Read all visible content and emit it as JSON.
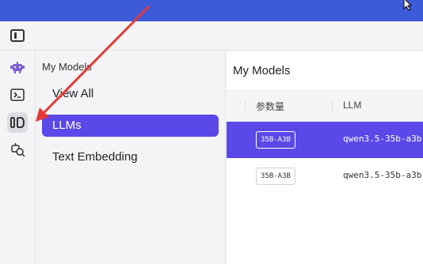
{
  "sidebar_panel": {
    "title": "My Models",
    "items": [
      {
        "label": "View All"
      },
      {
        "label": "LLMs"
      },
      {
        "label": "Text Embedding"
      }
    ]
  },
  "main": {
    "title": "My Models",
    "columns": [
      "参数量",
      "LLM"
    ],
    "rows": [
      {
        "size": "35B-A3B",
        "model": "qwen3.5-35b-a3b",
        "selected": true
      },
      {
        "size": "35B-A3B",
        "model": "qwen3.5-35b-a3b",
        "selected": false
      }
    ]
  },
  "colors": {
    "titlebar": "#3d5bd9",
    "accent": "#5b48e8",
    "annotation_arrow": "#e53935",
    "rail_icon_top": "#7b5fd6"
  },
  "icons": {
    "toolbar": "sidebar-toggle-icon",
    "rail": [
      "robot-icon",
      "terminal-icon",
      "models-library-icon",
      "model-search-icon"
    ]
  }
}
